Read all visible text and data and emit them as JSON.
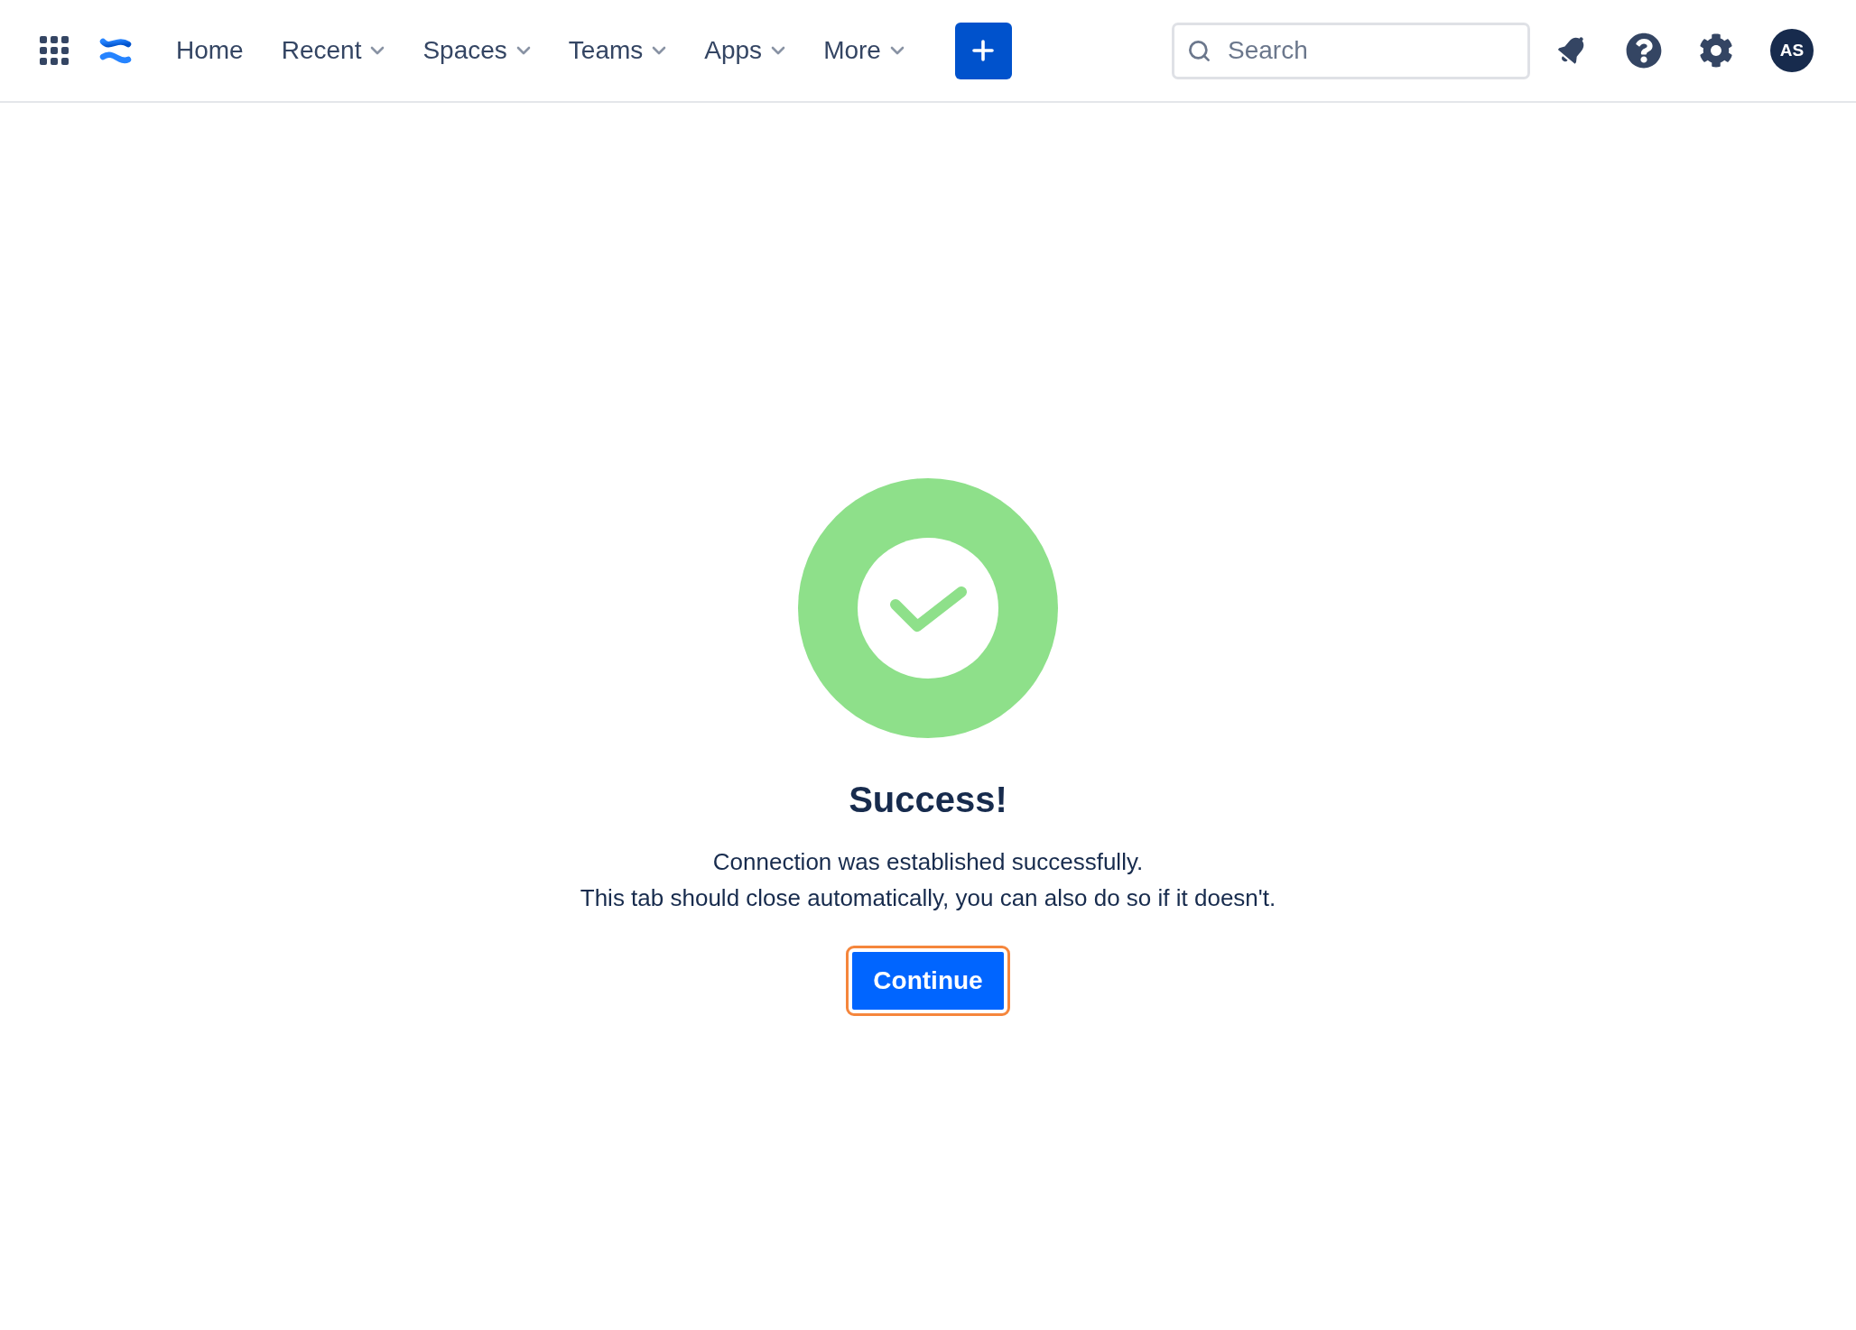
{
  "nav": {
    "items": [
      {
        "label": "Home",
        "has_menu": false
      },
      {
        "label": "Recent",
        "has_menu": true
      },
      {
        "label": "Spaces",
        "has_menu": true
      },
      {
        "label": "Teams",
        "has_menu": true
      },
      {
        "label": "Apps",
        "has_menu": true
      },
      {
        "label": "More",
        "has_menu": true
      }
    ]
  },
  "search": {
    "placeholder": "Search"
  },
  "user": {
    "initials": "AS"
  },
  "message": {
    "title": "Success!",
    "lines": [
      "Connection was established successfully.",
      "This tab should close automatically, you can also do so if it doesn't."
    ],
    "button": {
      "label": "Continue",
      "focused": true
    }
  }
}
